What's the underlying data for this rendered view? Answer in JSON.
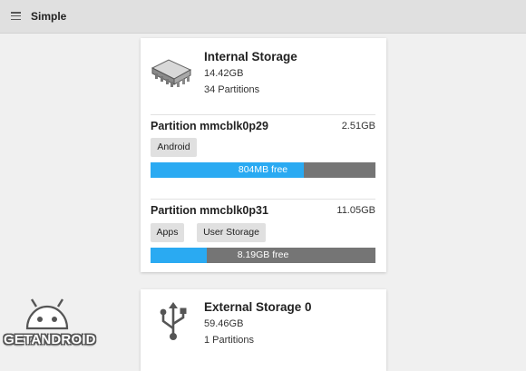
{
  "appbar": {
    "title": "Simple",
    "menu_icon": "hamburger-menu-icon"
  },
  "internal": {
    "title": "Internal Storage",
    "size": "14.42GB",
    "partitions": "34 Partitions",
    "icon": "memory-chip-icon",
    "items": [
      {
        "name": "Partition mmcblk0p29",
        "size": "2.51GB",
        "chips": [
          "Android"
        ],
        "free_text": "804MB free",
        "used_fraction": 0.68
      },
      {
        "name": "Partition mmcblk0p31",
        "size": "11.05GB",
        "chips": [
          "Apps",
          "User Storage"
        ],
        "free_text": "8.19GB free",
        "used_fraction": 0.25
      }
    ]
  },
  "external": {
    "title": "External Storage 0",
    "size": "59.46GB",
    "partitions": "1 Partitions",
    "icon": "usb-icon"
  },
  "watermark": {
    "text": "GETANDROID",
    "icon": "android-robot-icon"
  },
  "colors": {
    "appbar": "#e0e0e0",
    "bar_fill": "#2aaaf2",
    "bar_bg": "#757575",
    "chip_bg": "#e0e0e0"
  }
}
